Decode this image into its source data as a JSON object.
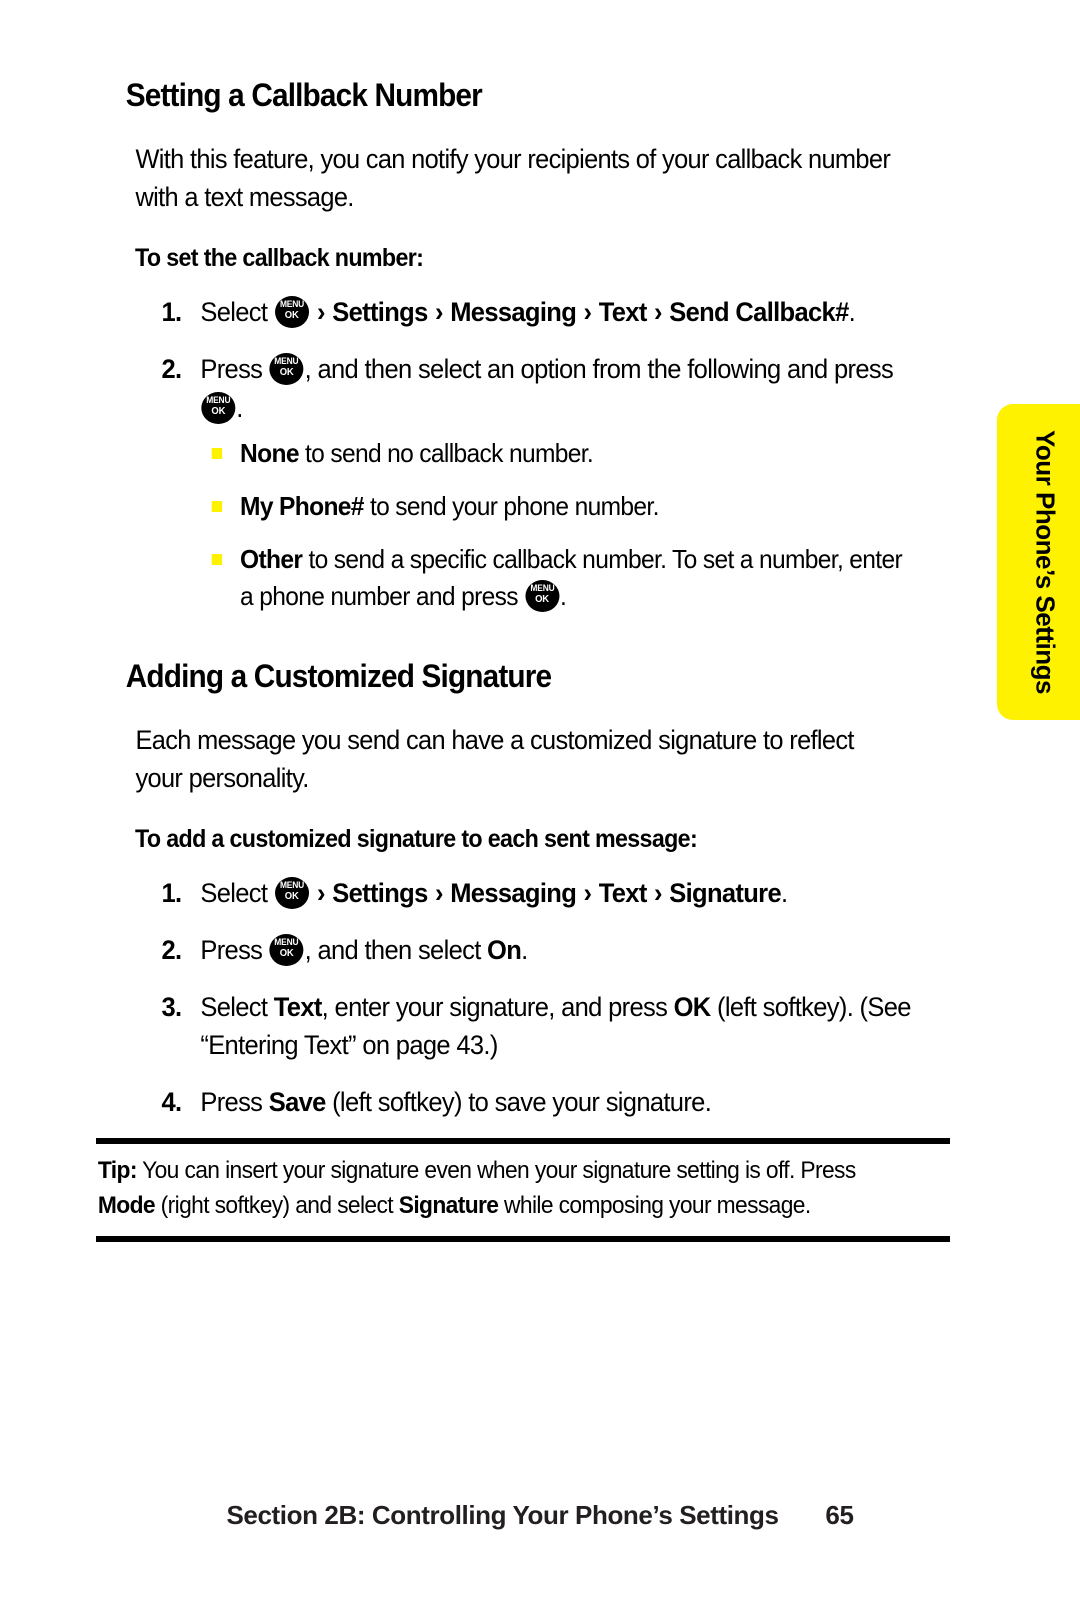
{
  "colors": {
    "accent_yellow": "#fff200",
    "text": "#000000",
    "footer_text": "#231f20"
  },
  "icons": {
    "menu_key": {
      "top": "MENU",
      "bottom": "OK"
    },
    "chevron": "›"
  },
  "sections": [
    {
      "heading": "Setting a Callback Number",
      "body": "With this feature, you can notify your recipients of your callback number with a text message.",
      "lead_in": "To set the callback number:",
      "steps": [
        {
          "number": "1.",
          "parts": [
            {
              "t": "text",
              "v": "Select "
            },
            {
              "t": "key"
            },
            {
              "t": "chev"
            },
            {
              "t": "bold",
              "v": "Settings"
            },
            {
              "t": "chev"
            },
            {
              "t": "bold",
              "v": "Messaging"
            },
            {
              "t": "chev"
            },
            {
              "t": "bold",
              "v": "Text"
            },
            {
              "t": "chev"
            },
            {
              "t": "bold",
              "v": "Send Callback#"
            },
            {
              "t": "text",
              "v": "."
            }
          ]
        },
        {
          "number": "2.",
          "parts": [
            {
              "t": "text",
              "v": "Press "
            },
            {
              "t": "key"
            },
            {
              "t": "text",
              "v": ", and then select an option from the following and press "
            },
            {
              "t": "key"
            },
            {
              "t": "text",
              "v": "."
            }
          ],
          "bullets": [
            [
              {
                "t": "bold",
                "v": "None"
              },
              {
                "t": "text",
                "v": " to send no callback number."
              }
            ],
            [
              {
                "t": "bold",
                "v": "My Phone#"
              },
              {
                "t": "text",
                "v": " to send your phone number."
              }
            ],
            [
              {
                "t": "bold",
                "v": "Other"
              },
              {
                "t": "text",
                "v": " to send a specific callback number. To set a number, enter a phone number and press "
              },
              {
                "t": "key"
              },
              {
                "t": "text",
                "v": "."
              }
            ]
          ]
        }
      ]
    },
    {
      "heading": "Adding a Customized Signature",
      "body": "Each message you send can have a customized signature to reflect your personality.",
      "lead_in": "To add a customized signature to each sent message:",
      "steps": [
        {
          "number": "1.",
          "parts": [
            {
              "t": "text",
              "v": "Select "
            },
            {
              "t": "key"
            },
            {
              "t": "chev"
            },
            {
              "t": "bold",
              "v": "Settings"
            },
            {
              "t": "chev"
            },
            {
              "t": "bold",
              "v": "Messaging"
            },
            {
              "t": "chev"
            },
            {
              "t": "bold",
              "v": "Text"
            },
            {
              "t": "chev"
            },
            {
              "t": "bold",
              "v": "Signature"
            },
            {
              "t": "text",
              "v": "."
            }
          ]
        },
        {
          "number": "2.",
          "parts": [
            {
              "t": "text",
              "v": "Press "
            },
            {
              "t": "key"
            },
            {
              "t": "text",
              "v": ", and then select "
            },
            {
              "t": "bold",
              "v": "On"
            },
            {
              "t": "text",
              "v": "."
            }
          ]
        },
        {
          "number": "3.",
          "parts": [
            {
              "t": "text",
              "v": "Select "
            },
            {
              "t": "bold",
              "v": "Text"
            },
            {
              "t": "text",
              "v": ", enter your signature, and press "
            },
            {
              "t": "bold",
              "v": "OK"
            },
            {
              "t": "text",
              "v": " (left softkey). (See “Entering Text” on page 43.)"
            }
          ]
        },
        {
          "number": "4.",
          "parts": [
            {
              "t": "text",
              "v": "Press "
            },
            {
              "t": "bold",
              "v": "Save"
            },
            {
              "t": "text",
              "v": " (left softkey) to save your signature."
            }
          ]
        }
      ]
    }
  ],
  "tip": {
    "parts": [
      {
        "t": "bold",
        "v": "Tip:"
      },
      {
        "t": "text",
        "v": " You can insert your signature even when your signature setting is off. Press "
      },
      {
        "t": "bold",
        "v": "Mode"
      },
      {
        "t": "text",
        "v": " (right softkey) and select "
      },
      {
        "t": "bold",
        "v": "Signature"
      },
      {
        "t": "text",
        "v": " while composing your message."
      }
    ]
  },
  "side_tab": {
    "label": "Your Phone’s Settings"
  },
  "footer": {
    "section_label": "Section 2B: Controlling Your Phone’s Settings",
    "page_number": "65"
  }
}
